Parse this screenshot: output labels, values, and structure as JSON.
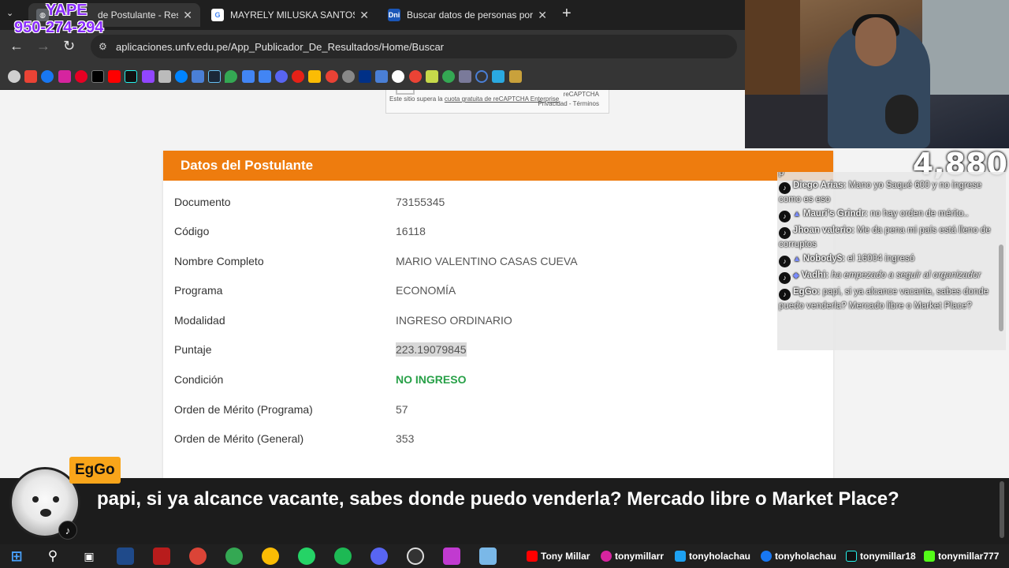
{
  "browser": {
    "tabs": [
      {
        "title": "de Postulante - Resul",
        "active": true,
        "favicon": "globe-icon"
      },
      {
        "title": "MAYRELY MILUSKA SANTOS CA",
        "active": false,
        "favicon": "google-icon"
      },
      {
        "title": "Buscar datos de personas por D",
        "active": false,
        "favicon": "dni-icon",
        "favicon_text": "Dni"
      }
    ],
    "new_tab_symbol": "+",
    "close_symbol": "✕",
    "url": "aplicaciones.unfv.edu.pe/App_Publicador_De_Resultados/Home/Buscar"
  },
  "recaptcha": {
    "text_prefix": "Este sitio supera la ",
    "link_text": "cuota gratuita de reCAPTCHA Enterprise",
    "brand": "reCAPTCHA",
    "privacy": "Privacidad - Términos"
  },
  "card": {
    "header": "Datos del Postulante",
    "rows": [
      {
        "label": "Documento",
        "value": "73155345"
      },
      {
        "label": "Código",
        "value": "16118"
      },
      {
        "label": "Nombre Completo",
        "value": "MARIO VALENTINO CASAS CUEVA"
      },
      {
        "label": "Programa",
        "value": "ECONOMÍA"
      },
      {
        "label": "Modalidad",
        "value": "INGRESO ORDINARIO"
      },
      {
        "label": "Puntaje",
        "value": "223.19079845"
      },
      {
        "label": "Condición",
        "value": "NO INGRESO"
      },
      {
        "label": "Orden de Mérito (Programa)",
        "value": "57"
      },
      {
        "label": "Orden de Mérito (General)",
        "value": "353"
      }
    ],
    "header_color": "#ee7c0e",
    "status_color": "#27a047"
  },
  "overlay": {
    "yape_line1": "YAPE",
    "yape_line2": "950-274-294",
    "viewer_count": "4,880",
    "chat": [
      {
        "user": "",
        "text": "p",
        "badge": ""
      },
      {
        "user": "Diego Arias:",
        "text": "Mano yo Saqué 600 y no ingrese como es eso",
        "badge": ""
      },
      {
        "user": "Mauri's Grindr:",
        "text": "no hay orden de mérito..",
        "badge": "▲"
      },
      {
        "user": "Jhoan valerio:",
        "text": "Me da pena mi país está lleno de corruptos",
        "badge": ""
      },
      {
        "user": "Nobody$:",
        "text": "el 16004 ingresó",
        "badge": "▲"
      },
      {
        "user": "Vadhi:",
        "text": "ha empezado a seguir al organizador",
        "badge": "◆"
      },
      {
        "user": "EgGo:",
        "text": "papi, si ya alcance vacante, sabes donde puedo venderla? Mercado libre o Market Place?",
        "badge": ""
      }
    ],
    "highlight_user": "EgGo",
    "highlight_text": "papi, si ya alcance vacante, sabes donde puedo venderla? Mercado libre o Market Place?"
  },
  "taskbar": {
    "socials": [
      {
        "icon": "youtube-icon",
        "text": "Tony Millar"
      },
      {
        "icon": "instagram-icon",
        "text": "tonymillarr"
      },
      {
        "icon": "twitter-icon",
        "text": "tonyholachau"
      },
      {
        "icon": "facebook-icon",
        "text": "tonyholachau"
      },
      {
        "icon": "tiktok-icon",
        "text": "tonymillar18"
      },
      {
        "icon": "kick-icon",
        "text": "tonymillar777"
      }
    ]
  }
}
